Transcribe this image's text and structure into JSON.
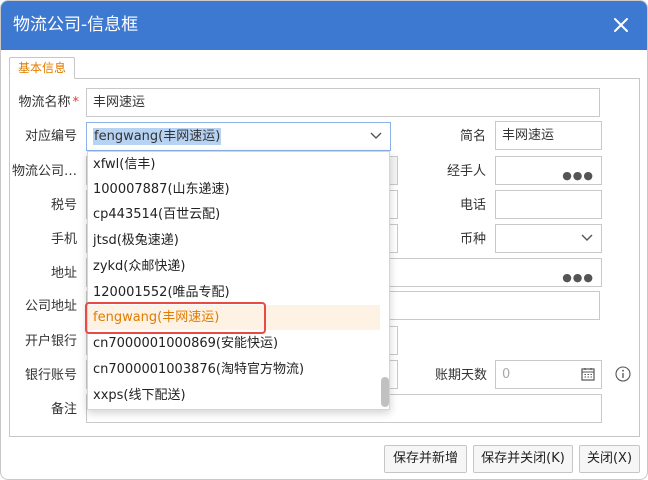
{
  "window": {
    "title": "物流公司-信息框"
  },
  "tabs": [
    {
      "label": "基本信息"
    }
  ],
  "form": {
    "name": {
      "label": "物流名称",
      "required_mark": "*",
      "value": "丰网速运"
    },
    "code": {
      "label": "对应编号",
      "value": "fengwang(丰网速运)"
    },
    "short_name": {
      "label": "简名",
      "value": "丰网速运"
    },
    "company_label": {
      "label": "物流公司…"
    },
    "handler": {
      "label": "经手人",
      "value": ""
    },
    "tax_no": {
      "label": "税号"
    },
    "phone": {
      "label": "电话",
      "value": ""
    },
    "mobile": {
      "label": "手机"
    },
    "currency": {
      "label": "币种",
      "value": ""
    },
    "address": {
      "label": "地址"
    },
    "company_address": {
      "label": "公司地址"
    },
    "bank": {
      "label": "开户银行"
    },
    "account": {
      "label": "银行账号"
    },
    "payment_days": {
      "label": "账期天数",
      "placeholder": "0"
    },
    "remark": {
      "label": "备注"
    }
  },
  "dropdown": {
    "items": [
      {
        "label": "xfwl(信丰)"
      },
      {
        "label": "100007887(山东递速)"
      },
      {
        "label": "cp443514(百世云配)"
      },
      {
        "label": "jtsd(极兔速递)"
      },
      {
        "label": "zykd(众邮快递)"
      },
      {
        "label": "120001552(唯品专配)"
      },
      {
        "label": "fengwang(丰网速运)",
        "selected": true
      },
      {
        "label": "cn7000001000869(安能快运)"
      },
      {
        "label": "cn7000001003876(淘特官方物流)"
      },
      {
        "label": "xxps(线下配送)"
      }
    ]
  },
  "buttons": {
    "save_new": "保存并新增",
    "save_close": "保存并关闭(K)",
    "close": "关闭(X)"
  },
  "icons": {
    "close": "close-icon",
    "chevron": "chevron-down-icon",
    "more": "more-dots-icon",
    "calendar": "calendar-icon",
    "info": "info-icon"
  },
  "colors": {
    "titlebar": "#3d78d1",
    "tab_text": "#e07c00",
    "required": "#ee3333",
    "selection": "#b7d3f3",
    "selected_item_bg": "#fdf2e4",
    "highlight_box": "#e84a44"
  }
}
